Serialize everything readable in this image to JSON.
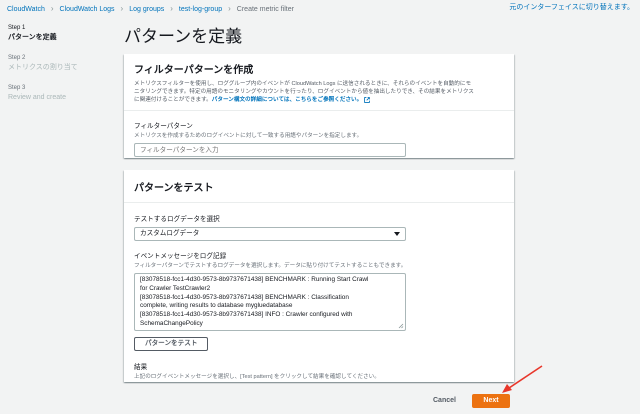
{
  "breadcrumb": {
    "items": [
      "CloudWatch",
      "CloudWatch Logs",
      "Log groups",
      "test-log-group",
      "Create metric filter"
    ]
  },
  "old_ui_link": "元のインターフェイスに切り替えます。",
  "steps": [
    {
      "number": "Step 1",
      "label": "パターンを定義"
    },
    {
      "number": "Step 2",
      "label": "メトリクスの割り当て"
    },
    {
      "number": "Step 3",
      "label": "Review and create"
    }
  ],
  "page_title": "パターンを定義",
  "filter_panel": {
    "title": "フィルターパターンを作成",
    "desc_line1": "メトリクスフィルターを使用し、ロググループ内のイベントが CloudWatch Logs に送信されるときに、それらのイベントを自動的にモ",
    "desc_line2": "ニタリングできます。特定の用語のモニタリングやカウントを行ったり、ログイベントから値を抽出したりでき、その結果をメトリクス",
    "desc_line3": "に関連付けることができます。",
    "desc_link": "パターン構文の詳細については、こちらをご参照ください。",
    "field_label": "フィルターパターン",
    "field_desc": "メトリクスを作成するためのログイベントに対して一致する用語やパターンを指定します。",
    "input_placeholder": "フィルターパターンを入力"
  },
  "test_panel": {
    "title": "パターンをテスト",
    "select_label": "テストするログデータを選択",
    "select_value": "カスタムログデータ",
    "messages_label": "イベントメッセージをログ記録",
    "messages_desc": "フィルターパターンでテストするログデータを選択します。データに貼り付けてテストすることもできます。",
    "log_lines": [
      "[83078518-fcc1-4d30-9573-8b9737671438] BENCHMARK : Running Start Crawl",
      "for Crawler TestCrawler2",
      "[83078518-fcc1-4d30-9573-8b9737671438] BENCHMARK : Classification",
      "complete, writing results to database mygluedatabase",
      "[83078518-fcc1-4d30-9573-8b9737671438] INFO : Crawler configured with",
      "SchemaChangePolicy"
    ],
    "test_button": "パターンをテスト",
    "result_label": "結果",
    "result_desc": "上記のログイベントメッセージを選択し、[Test pattern] をクリックして結果を確認してください。"
  },
  "footer": {
    "cancel": "Cancel",
    "next": "Next"
  },
  "colors": {
    "link": "#0073bb",
    "primary_button": "#ec7211",
    "annotation_arrow": "#e8372b",
    "page_background": "#f2f3f3"
  }
}
